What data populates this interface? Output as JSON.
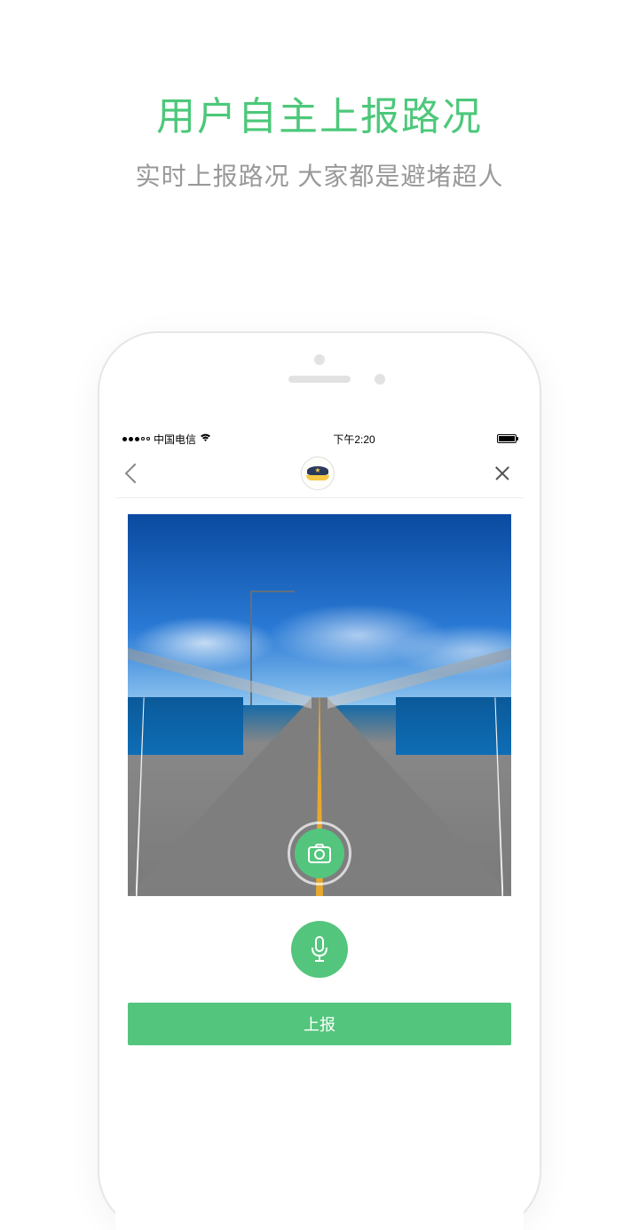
{
  "promo": {
    "title": "用户自主上报路况",
    "subtitle": "实时上报路况 大家都是避堵超人"
  },
  "status_bar": {
    "carrier": "中国电信",
    "time": "下午2:20"
  },
  "nav": {
    "badge_icon": "police-hat-icon"
  },
  "buttons": {
    "camera_icon": "camera-icon",
    "mic_icon": "microphone-icon",
    "submit_label": "上报"
  }
}
